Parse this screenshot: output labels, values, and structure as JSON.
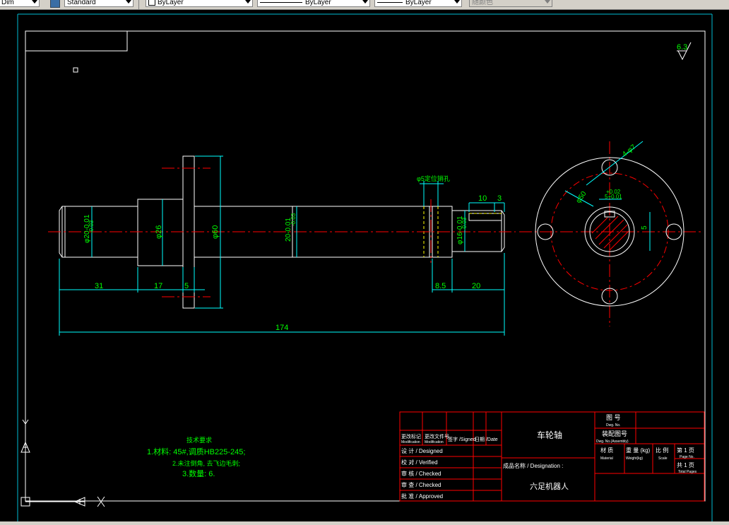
{
  "toolbar": {
    "dimstyle_value": "Dim",
    "textstyle_value": "Standard",
    "color_value": "ByLayer",
    "linetype_value": "ByLayer",
    "lineweight_value": "ByLayer",
    "plotstyle_value": "随颜色"
  },
  "drawing": {
    "surface_finish": "6.3",
    "dims": {
      "d1": "31",
      "d2": "17",
      "d3": "5",
      "d4": "174",
      "d5": "8.5",
      "d6": "20",
      "d7": "10",
      "d8": "3",
      "dia20": "φ20-0.01",
      "dia20b": "-0.03",
      "dia26": "φ26",
      "dia60": "φ60",
      "dia20mid": "20-0.01",
      "dia20midb": "-0.03",
      "dia16": "φ16-0.01",
      "dia16b": "-0.03",
      "pin_hole": "φ5定位销孔",
      "holes": "4-φ7",
      "bolt_circle": "φ50",
      "key_tol_top": "+0.02",
      "key_tol_bot": "5+0.01",
      "key_width": "5"
    },
    "tech_req": {
      "title": "技术要求",
      "line1": "1.材料: 45#,调质HB225-245;",
      "line2": "2.未注倒角, 去飞边毛刺;",
      "line3": "3.数量: 6."
    },
    "title_block": {
      "part_name": "车轮轴",
      "designation_label": "成品名称  / Designation :",
      "designation_value": "六足机器人",
      "drawing_no": "图 号",
      "drawing_no_en": "Dwg. No.",
      "assembly_no": "装配图号",
      "assembly_no_en": "Dwg. No.(Assembly)",
      "material": "材 质",
      "material_en": "Material",
      "weight": "重 量  (kg)",
      "weight_en": "Weight(kg)",
      "scale": "比 例",
      "scale_en": "Scale",
      "page": "第  1 页",
      "page_en": "Page No.",
      "total": "共  1 页",
      "total_en": "Total Pages",
      "col_mark": "更改标记",
      "col_mark_en": "Modification",
      "col_doc": "更改文件号",
      "col_doc_en": "Modification",
      "col_sign": "签字 /Signed",
      "col_date": "日期 /Date",
      "designed": "设 计   / Designed",
      "verified": "校 对   / Verified",
      "checked1": "审 核   / Checked",
      "checked2": "审 查   / Checked",
      "approved": "批 准   / Approved"
    },
    "ucs": {
      "x": "X",
      "y": "Y"
    }
  }
}
